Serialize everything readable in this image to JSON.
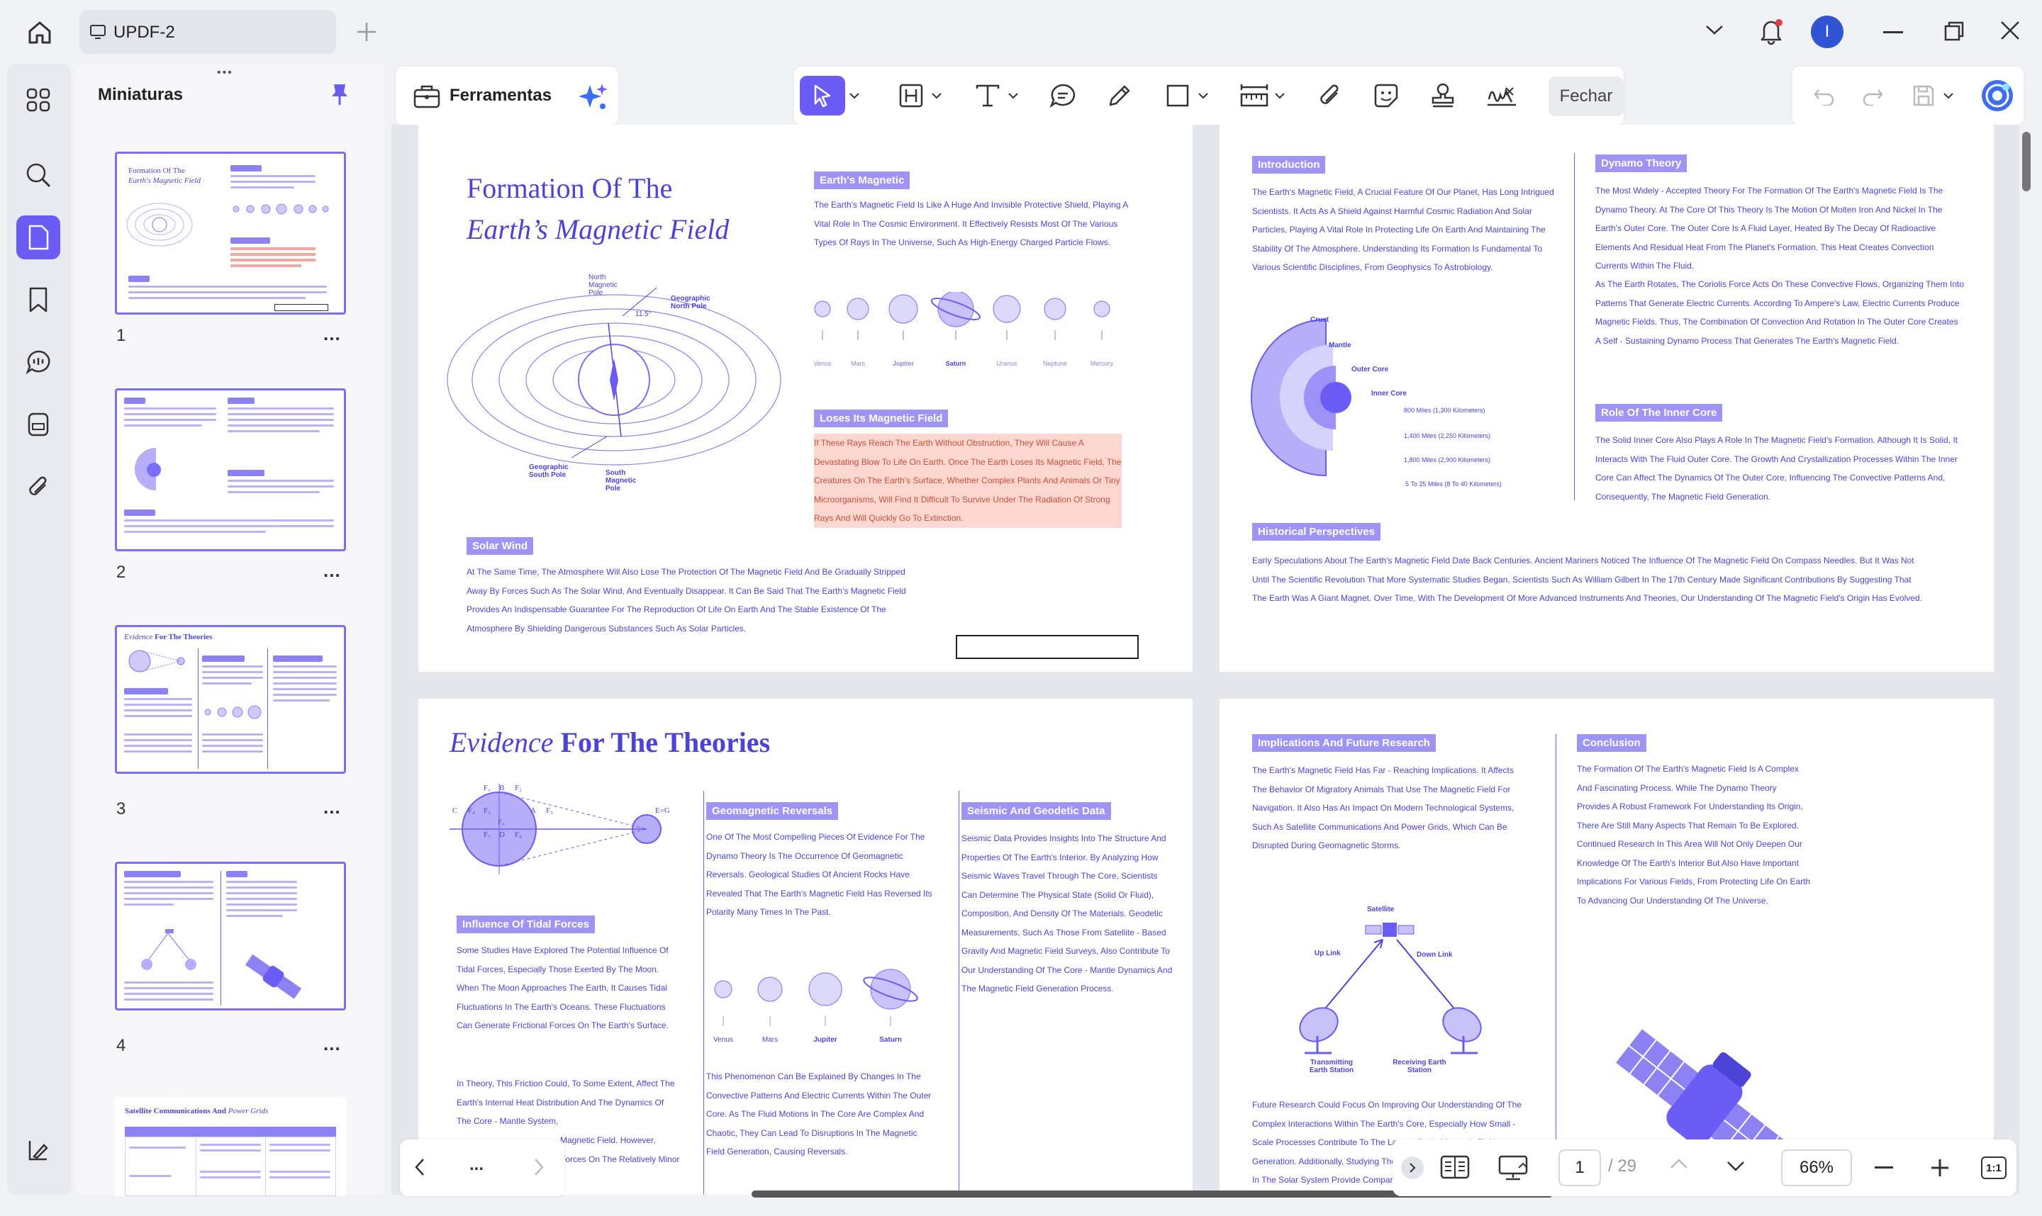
{
  "app": {
    "tab_title": "UPDF-2",
    "accent": "#6b5cf6"
  },
  "sidebar": {
    "title": "Miniaturas",
    "icons": [
      "grid-icon",
      "search-icon",
      "pages-icon",
      "bookmark-icon",
      "comment-icon",
      "form-icon",
      "attachment-icon",
      "layers-icon"
    ],
    "thumbnails": [
      {
        "number": "1",
        "heading_a": "Formation Of The",
        "heading_b": "Earth's Magnetic Field"
      },
      {
        "number": "2"
      },
      {
        "number": "3",
        "heading_a": "Evidence",
        "heading_b": "For The Theories"
      },
      {
        "number": "4"
      },
      {
        "number": "",
        "heading_a": "Satellite Communications And",
        "heading_b": "Power Grids"
      }
    ],
    "more": "..."
  },
  "toolbar": {
    "tools_label": "Ferramentas",
    "close_label": "Fechar"
  },
  "pages": {
    "p1": {
      "title_line1": "Formation Of The",
      "title_line2": "Earth’s Magnetic Field",
      "earths_magnetic_header": "Earth's Magnetic",
      "earths_magnetic_text": "The Earth's Magnetic Field Is Like A Huge And Invisible Protective Shield, Playing A Vital Role In The Cosmic Environment. It Effectively Resists Most Of The Various Types Of Rays In The Universe, Such As High-Energy Charged Particle Flows.",
      "planets": [
        "Venus",
        "Mars",
        "Jupiter",
        "Saturn",
        "Uranus",
        "Neptune",
        "Mercury"
      ],
      "loses_header": "Loses Its Magnetic Field",
      "loses_text": "If These Rays Reach The Earth Without Obstruction, They Will Cause A Devastating Blow To Life On Earth. Once The Earth Loses Its Magnetic Field, The Creatures On The Earth's Surface, Whether Complex Plants And Animals Or Tiny Microorganisms, Will Find It Difficult To Survive Under The Radiation Of Strong Rays And Will Quickly Go To Extinction.",
      "solar_header": "Solar Wind",
      "solar_text": "At The Same Time, The Atmosphere Will Also Lose The Protection Of The Magnetic Field And Be Gradually Stripped Away By Forces Such As The Solar Wind, And Eventually Disappear. It Can Be Said That The Earth's Magnetic Field Provides An Indispensable Guarantee For The Reproduction Of Life On Earth And The Stable Existence Of The Atmosphere By Shielding Dangerous Substances Such As Solar Particles.",
      "diagram_labels": {
        "north_mag": "North Magnetic Pole",
        "geo_north": "Geographic North Pole",
        "geo_south": "Geographic South Pole",
        "south_mag": "South Magnetic Pole",
        "angle": "11.5°"
      }
    },
    "p2": {
      "intro_header": "Introduction",
      "intro_text": "The Earth's Magnetic Field, A Crucial Feature Of Our Planet, Has Long Intrigued Scientists. It Acts As A Shield Against Harmful Cosmic Radiation And Solar Particles, Playing A Vital Role In Protecting Life On Earth And Maintaining The Stability Of The Atmosphere. Understanding Its Formation Is Fundamental To Various Scientific Disciplines, From Geophysics To Astrobiology.",
      "layers": [
        "Crust",
        "Mantle",
        "Outer Core",
        "Inner Core"
      ],
      "depths": [
        "800 Miles (1,300 Kilometers)",
        "1,400 Miles (2,250 Kilometers)",
        "1,800 Miles (2,900 Kilometers)",
        "5 To 25 Miles (8 To 40 Kilometers)"
      ],
      "dynamo_header": "Dynamo Theory",
      "dynamo_text": "The Most Widely - Accepted Theory For The Formation Of The Earth's Magnetic Field Is The Dynamo Theory. At The Core Of This Theory Is The Motion Of Molten Iron And Nickel In The Earth's Outer Core. The Outer Core Is A Fluid Layer, Heated By The Decay Of Radioactive Elements And Residual Heat From The Planet's Formation. This Heat Creates Convection Currents Within The Fluid.",
      "dynamo_text2": "As The Earth Rotates, The Coriolis Force Acts On These Convective Flows, Organizing Them Into Patterns That Generate Electric Currents. According To Ampere's Law, Electric Currents Produce Magnetic Fields. Thus, The Combination Of Convection And Rotation In The Outer Core Creates A Self - Sustaining Dynamo Process That Generates The Earth's Magnetic Field.",
      "inner_header": "Role Of The Inner Core",
      "inner_text": "The Solid Inner Core Also Plays A Role In The Magnetic Field's Formation. Although It Is Solid, It Interacts With The Fluid Outer Core. The Growth And Crystallization Processes Within The Inner Core Can Affect The Dynamics Of The Outer Core, Influencing The Convective Patterns And, Consequently, The Magnetic Field Generation.",
      "hist_header": "Historical Perspectives",
      "hist_text": "Early Speculations About The Earth's Magnetic Field Date Back Centuries. Ancient Mariners Noticed The Influence Of The Magnetic Field On Compass Needles. But It Was Not Until The Scientific Revolution That More Systematic Studies Began. Scientists Such As William Gilbert In The 17th Century Made Significant Contributions By Suggesting That The Earth Was A Giant Magnet. Over Time, With The Development Of More Advanced Instruments And Theories, Our Understanding Of The Magnetic Field's Origin Has Evolved."
    },
    "p3": {
      "title_italic": "Evidence",
      "title_rest": "For The Theories",
      "tidal_header": "Influence Of Tidal Forces",
      "tidal_text": "Some Studies Have Explored The Potential Influence Of Tidal Forces, Especially Those Exerted By The Moon. When The Moon Approaches The Earth, It Causes Tidal Fluctuations In The Earth's Oceans. These Fluctuations Can Generate Frictional Forces On The Earth's Surface.",
      "tidal_text2": "In Theory, This Friction Could, To Some Extent, Affect The Earth's Internal Heat Distribution And The Dynamics Of The Core - Mantle System,",
      "tidal_text3": "Magnetic Field. However, Forces On The Relatively Minor",
      "geo_header": "Geomagnetic Reversals",
      "geo_text": "One Of The Most Compelling Pieces Of Evidence For The Dynamo Theory Is The Occurrence Of Geomagnetic Reversals. Geological Studies Of Ancient Rocks Have Revealed That The Earth's Magnetic Field Has Reversed Its Polarity Many Times In The Past.",
      "geo_text2": "This Phenomenon Can Be Explained By Changes In The Convective Patterns And Electric Currents Within The Outer Core. As The Fluid Motions In The Core Are Complex And Chaotic, They Can Lead To Disruptions In The Magnetic Field Generation, Causing Reversals.",
      "planets": [
        "Venus",
        "Mars",
        "Jupiter",
        "Saturn"
      ],
      "seismic_header": "Seismic And Geodetic Data",
      "seismic_text": "Seismic Data Provides Insights Into The Structure And Properties Of The Earth's Interior. By Analyzing How Seismic Waves Travel Through The Core, Scientists Can Determine The Physical State (Solid Or Fluid), Composition, And Density Of The Materials. Geodetic Measurements, Such As Those From Satellite - Based Gravity And Magnetic Field Surveys, Also Contribute To Our Understanding Of The Core - Mantle Dynamics And The Magnetic Field Generation Process.",
      "force_labels": [
        "F₁",
        "B",
        "F₂",
        "C",
        "F₄",
        "F₃",
        "A",
        "F₅",
        "F₆",
        "F₇",
        "D",
        "F₈",
        "E=G"
      ]
    },
    "p4": {
      "impl_header": "Implications And Future Research",
      "impl_text": "The Earth's Magnetic Field Has Far - Reaching Implications. It Affects The Behavior Of Migratory Animals That Use The Magnetic Field For Navigation. It Also Has An Impact On Modern Technological Systems, Such As Satellite Communications And Power Grids, Which Can Be Disrupted During Geomagnetic Storms.",
      "sat_labels": {
        "satellite": "Satellite",
        "uplink": "Up Link",
        "downlink": "Down Link",
        "tx": "Transmitting Earth Station",
        "rx": "Receiving Earth Station"
      },
      "impl_text2": "Future Research Could Focus On Improving Our Understanding Of The Complex Interactions Within The Earth's Core, Especially How Small - Scale Processes Contribute To The Large - Scale Magnetic Field Generation. Additionally, Studying The Magnetic Fields Of Other Planets In The Solar System Provide Comparative Insights And",
      "concl_header": "Conclusion",
      "concl_text": "The Formation Of The Earth's Magnetic Field Is A Complex And Fascinating Process. While The Dynamo Theory Provides A Robust Framework For Understanding Its Origin, There Are Still Many Aspects That Remain To Be Explored. Continued Research In This Area Will Not Only Deepen Our Knowledge Of The Earth's Interior But Also Have Important Implications For Various Fields, From Protecting Life On Earth To Advancing Our Understanding Of The Universe."
    }
  },
  "navigation": {
    "more": "...",
    "current_page": "1",
    "total_pages": "/ 29",
    "zoom": "66%",
    "fit_label": "1:1"
  }
}
